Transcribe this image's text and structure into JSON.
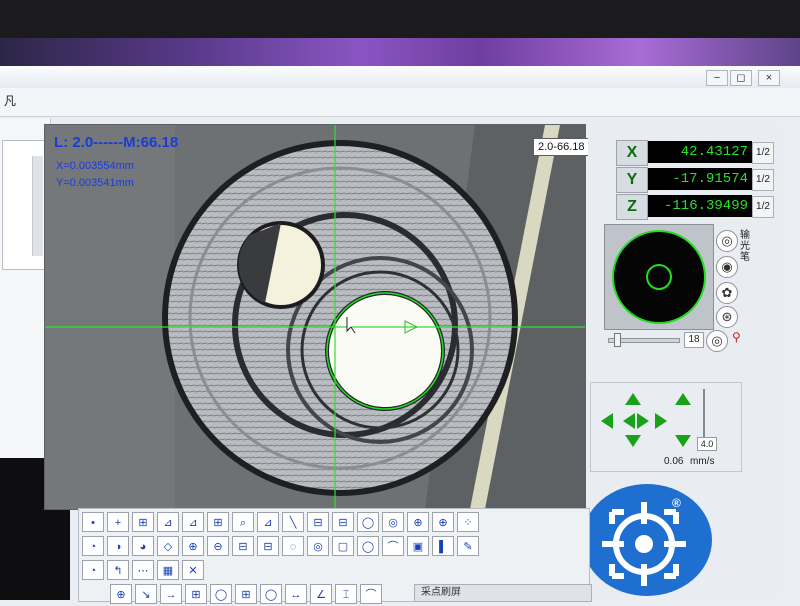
{
  "menu": {
    "label": "凡"
  },
  "window_controls": {
    "minimize": "−",
    "maximize": "◻",
    "close": "×"
  },
  "video": {
    "lens_info": "L: 2.0------M:66.18",
    "pixel_x": "X=0.003554mm",
    "pixel_y": "Y=0.003541mm",
    "zoom_select": "2.0-66.18"
  },
  "dro": {
    "axes": [
      {
        "label": "X",
        "value": "42.43127",
        "half": "1/2"
      },
      {
        "label": "Y",
        "value": "-17.91574",
        "half": "1/2"
      },
      {
        "label": "Z",
        "value": "-116.39499",
        "half": "1/2"
      }
    ],
    "light_label": "输光笔",
    "light_level": "18"
  },
  "motion": {
    "speed_setting": "4.0",
    "speed_readout": "0.06",
    "speed_unit": "mm/s"
  },
  "logo": {
    "mark": "®"
  },
  "toolbar": {
    "rows": [
      [
        "•",
        "+",
        "⊞",
        "⊿",
        "⊿",
        "⊞",
        "⌕",
        "⊿",
        "╲",
        "⊟",
        "⊟",
        "◯",
        "◎",
        "⊕",
        "⊕",
        "⁘"
      ],
      [
        "◔",
        "◑",
        "◕",
        "◇",
        "⊕",
        "⊖",
        "⊟",
        "⊟",
        "◌",
        "◎",
        "▢",
        "◯",
        "⌒",
        "▣",
        "▌",
        "✎"
      ],
      [
        "◔",
        "↰",
        "⋯",
        "▦",
        "✕"
      ],
      [
        "⊕",
        "↘",
        "→",
        "⊞",
        "◯",
        "⊞",
        "◯",
        "↔",
        "∠",
        "⌶",
        "⌒"
      ]
    ],
    "bottom_field": "采点刷屏"
  },
  "colors": {
    "dro_text": "#28e028",
    "circle_fit": "#22dd22",
    "overlay_text": "#1a3bd8",
    "logo_blue": "#1e6fd0"
  }
}
